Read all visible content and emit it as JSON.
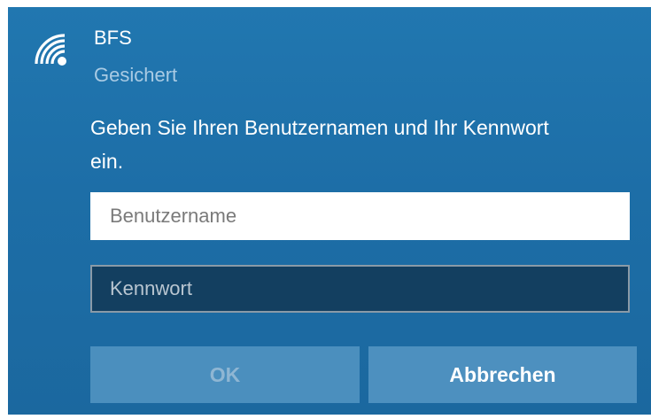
{
  "network": {
    "name": "BFS",
    "status": "Gesichert",
    "icon": "wifi-secured-icon"
  },
  "prompt": {
    "text": "Geben Sie Ihren Benutzernamen und Ihr Kennwort ein."
  },
  "form": {
    "username_placeholder": "Benutzername",
    "username_value": "",
    "password_placeholder": "Kennwort",
    "password_value": ""
  },
  "buttons": {
    "ok_label": "OK",
    "ok_enabled": false,
    "cancel_label": "Abbrechen"
  },
  "colors": {
    "panel_bg": "#1e6fa5",
    "password_bg": "#133f60",
    "button_bg": "#4d90bf",
    "secondary_text": "#a9cbe4"
  }
}
